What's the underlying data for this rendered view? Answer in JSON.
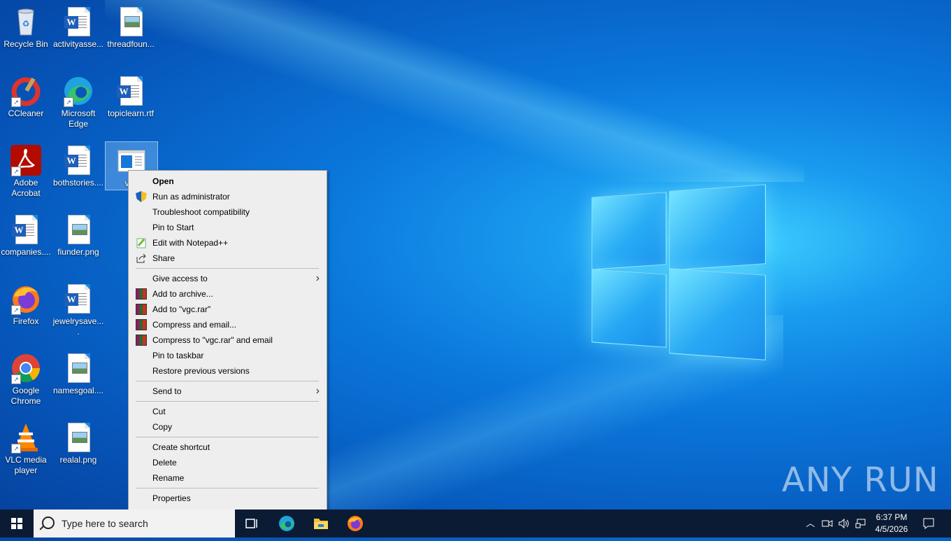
{
  "desktop": {
    "icons": [
      {
        "label": "Recycle Bin",
        "icon": "recycle-bin-icon"
      },
      {
        "label": "activityasse...",
        "icon": "word-document-icon"
      },
      {
        "label": "threadfoun...",
        "icon": "image-file-icon"
      },
      {
        "label": "CCleaner",
        "icon": "ccleaner-icon"
      },
      {
        "label": "Microsoft Edge",
        "icon": "edge-icon"
      },
      {
        "label": "topiclearn.rtf",
        "icon": "word-document-icon"
      },
      {
        "label": "Adobe Acrobat",
        "icon": "acrobat-icon"
      },
      {
        "label": "bothstories....",
        "icon": "word-document-icon"
      },
      {
        "label": "vgc",
        "icon": "application-icon"
      },
      {
        "label": "companies....",
        "icon": "word-document-icon"
      },
      {
        "label": "fiunder.png",
        "icon": "image-file-icon"
      },
      {
        "label": "Firefox",
        "icon": "firefox-icon"
      },
      {
        "label": "jewelrysave....",
        "icon": "word-document-icon"
      },
      {
        "label": "Google Chrome",
        "icon": "chrome-icon"
      },
      {
        "label": "namesgoal....",
        "icon": "image-file-icon"
      },
      {
        "label": "VLC media player",
        "icon": "vlc-icon"
      },
      {
        "label": "realal.png",
        "icon": "image-file-icon"
      }
    ]
  },
  "context_menu": {
    "items": [
      {
        "label": "Open"
      },
      {
        "label": "Run as administrator",
        "icon": "uac-shield-icon"
      },
      {
        "label": "Troubleshoot compatibility"
      },
      {
        "label": "Pin to Start"
      },
      {
        "label": "Edit with Notepad++",
        "icon": "notepadpp-icon"
      },
      {
        "label": "Share",
        "icon": "share-icon"
      },
      {
        "label": "Give access to"
      },
      {
        "label": "Add to archive...",
        "icon": "winrar-icon"
      },
      {
        "label": "Add to \"vgc.rar\"",
        "icon": "winrar-icon"
      },
      {
        "label": "Compress and email...",
        "icon": "winrar-icon"
      },
      {
        "label": "Compress to \"vgc.rar\" and email",
        "icon": "winrar-icon"
      },
      {
        "label": "Pin to taskbar"
      },
      {
        "label": "Restore previous versions"
      },
      {
        "label": "Send to"
      },
      {
        "label": "Cut"
      },
      {
        "label": "Copy"
      },
      {
        "label": "Create shortcut"
      },
      {
        "label": "Delete"
      },
      {
        "label": "Rename"
      },
      {
        "label": "Properties"
      }
    ]
  },
  "taskbar": {
    "search_placeholder": "Type here to search",
    "clock_time": "6:37 PM",
    "clock_date": "4/5/2026"
  },
  "watermark": "ANY RUN"
}
